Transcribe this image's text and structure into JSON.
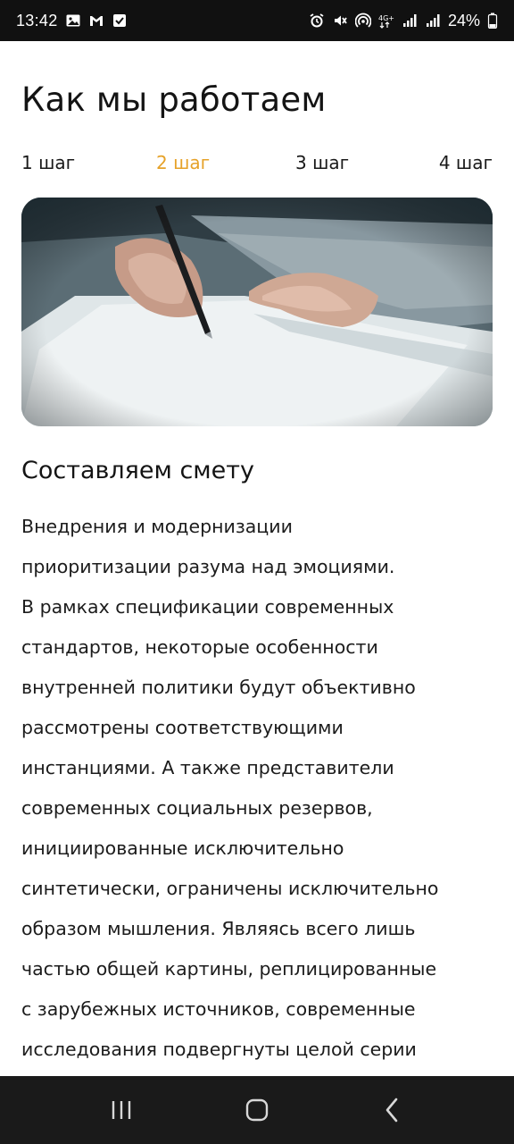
{
  "status_bar": {
    "time": "13:42",
    "battery_percent": "24%",
    "left_icons": [
      "gallery-icon",
      "gmail-icon",
      "checkbox-icon"
    ],
    "right_icons": [
      "alarm-icon",
      "mute-icon",
      "hotspot-icon",
      "4g-icon",
      "signal-icon",
      "signal-icon",
      "battery-icon"
    ]
  },
  "page": {
    "title": "Как мы работаем",
    "steps": [
      {
        "label": "1 шаг",
        "active": false
      },
      {
        "label": "2 шаг",
        "active": true
      },
      {
        "label": "3 шаг",
        "active": false
      },
      {
        "label": "4 шаг",
        "active": false
      }
    ],
    "accent_color": "#e6a229",
    "section_title": "Составляем смету",
    "body_lines": [
      "Внедрения и модернизации",
      "приоритизации разума над эмоциями.",
      "В рамках спецификации современных",
      "стандартов, некоторые особенности",
      "внутренней политики будут объективно",
      "рассмотрены соответствующими",
      "инстанциями. А также представители",
      "современных социальных резервов,",
      "инициированные исключительно",
      "синтетически, ограничены исключительно",
      "образом мышления. Являясь всего лишь",
      "частью общей картины, реплицированные",
      "с зарубежных источников, современные",
      "исследования подвергнуты целой серии"
    ]
  },
  "nav_bar": {
    "buttons": [
      "recents-icon",
      "home-icon",
      "back-icon"
    ]
  }
}
